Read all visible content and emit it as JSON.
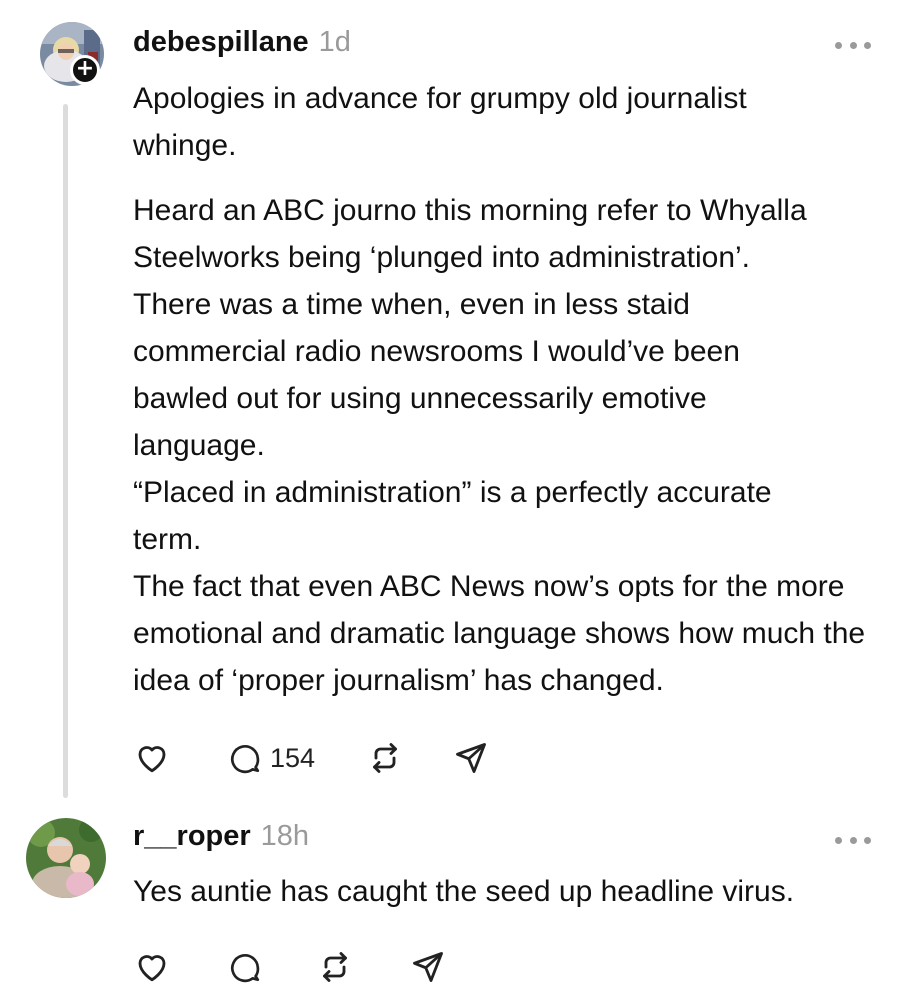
{
  "posts": [
    {
      "username": "debespillane",
      "time": "1d",
      "follow_icon": "plus-icon",
      "paragraphs": [
        "Apologies in advance for grumpy old journalist whinge.",
        "Heard an ABC journo this morning  refer to Whyalla Steelworks being ‘plunged into administration’.",
        "There was a time when, even in less staid commercial radio newsrooms I would’ve been bawled out for using unnecessarily emotive language.",
        "“Placed in administration” is a perfectly accurate term.",
        "The fact that even ABC News now’s opts for the more emotional and dramatic language shows how much the idea of ‘proper journalism’ has changed."
      ],
      "reply_count": "154"
    },
    {
      "username": "r__roper",
      "time": "18h",
      "text": "Yes auntie has caught the seed up headline virus."
    }
  ],
  "icons": [
    "heart-icon",
    "comment-icon",
    "repost-icon",
    "share-icon",
    "more-icon"
  ],
  "colors": {
    "text": "#111111",
    "muted": "#9a9a9a",
    "thread_line": "#dcdcdc"
  }
}
